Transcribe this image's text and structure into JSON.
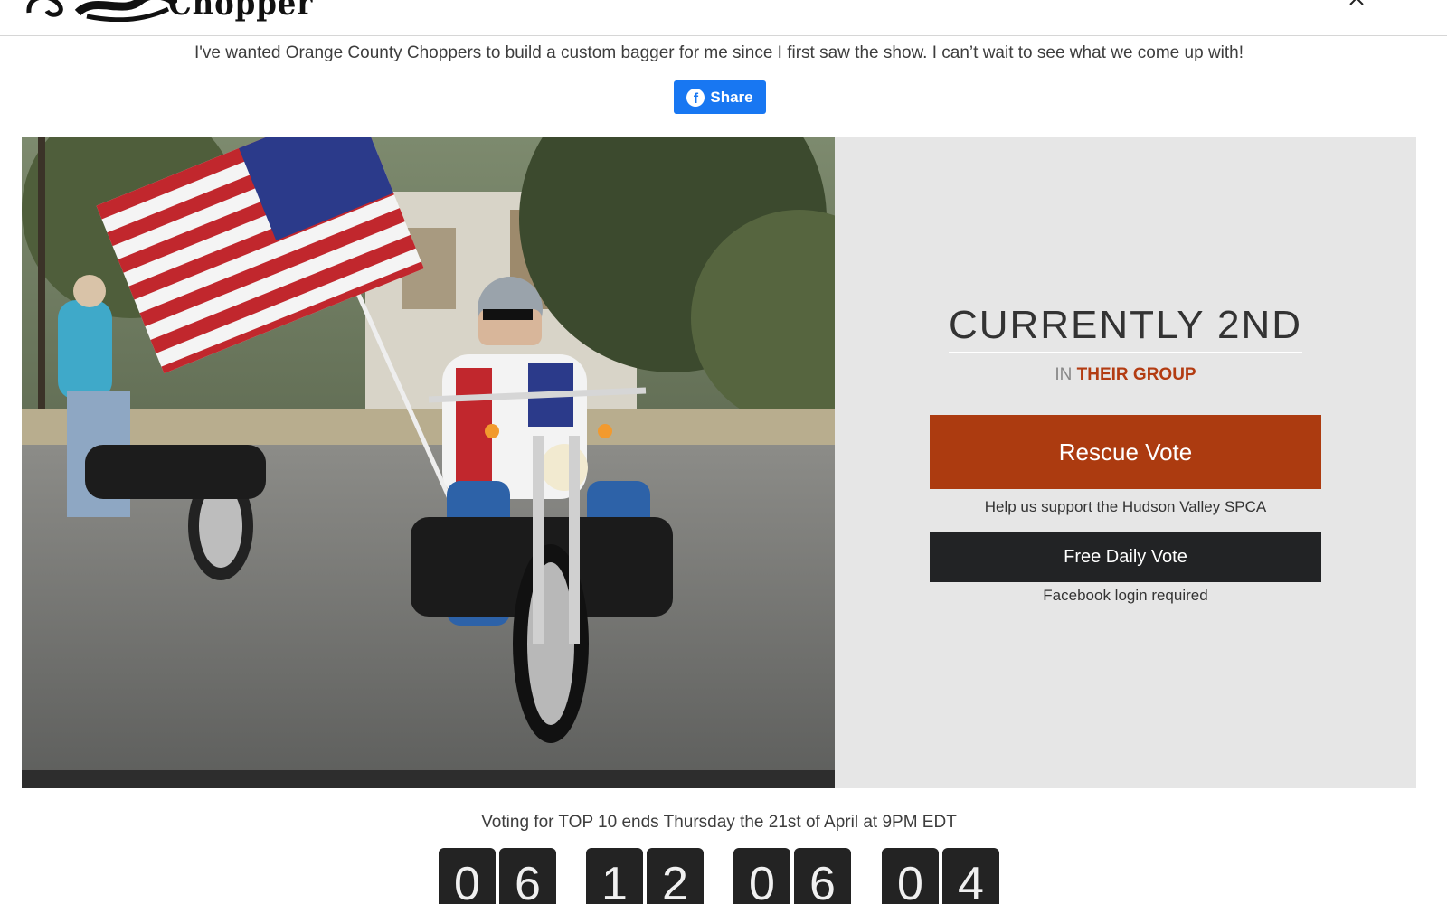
{
  "header": {
    "logo_text": "Chopper"
  },
  "quote": "I've wanted Orange County Choppers to build a custom bagger for me since I first saw the show. I can’t wait to see what we come up with!",
  "share": {
    "label": "Share",
    "icon": "facebook-icon",
    "color": "#1877f2"
  },
  "ranking": {
    "title": "CURRENTLY 2ND",
    "in_label": "IN",
    "group_label": "THEIR GROUP"
  },
  "rescue_vote": {
    "label": "Rescue Vote",
    "note": "Help us support the Hudson Valley SPCA",
    "color": "#ac3b10"
  },
  "free_vote": {
    "label": "Free Daily Vote",
    "note": "Facebook login required",
    "color": "#222325"
  },
  "voting_deadline": "Voting for TOP 10 ends Thursday the 21st of April at 9PM EDT",
  "countdown": {
    "days": [
      "0",
      "6"
    ],
    "hours": [
      "1",
      "2"
    ],
    "minutes": [
      "0",
      "6"
    ],
    "seconds": [
      "0",
      "4"
    ]
  }
}
